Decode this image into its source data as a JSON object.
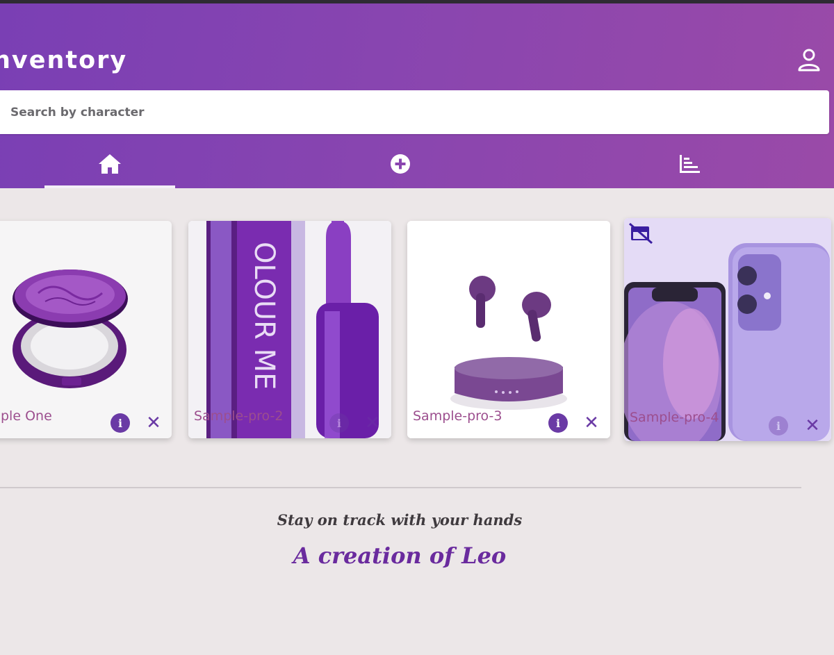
{
  "app": {
    "title": "nventory",
    "colors": {
      "header_start": "#7a3fb4",
      "header_end": "#9a4aa8",
      "accent": "#6a3aa5",
      "product_name": "#9c4e8e"
    }
  },
  "search": {
    "placeholder": "Search by character",
    "value": ""
  },
  "tabs": [
    {
      "icon": "home-icon",
      "selected": true
    },
    {
      "icon": "add-circle-icon",
      "selected": false
    },
    {
      "icon": "bar-chart-icon",
      "selected": false
    }
  ],
  "products": [
    {
      "name": "ple One",
      "image": "compact-mirror"
    },
    {
      "name": "Sample-pro-2",
      "image": "perfume-bottle"
    },
    {
      "name": "Sample-pro-3",
      "image": "wireless-earbuds"
    },
    {
      "name": "Sample-pro-4",
      "image": "purple-smartphone",
      "badge": "store-off-icon"
    }
  ],
  "footer": {
    "tagline": "Stay on track with your hands",
    "credit": "A creation of Leo"
  }
}
